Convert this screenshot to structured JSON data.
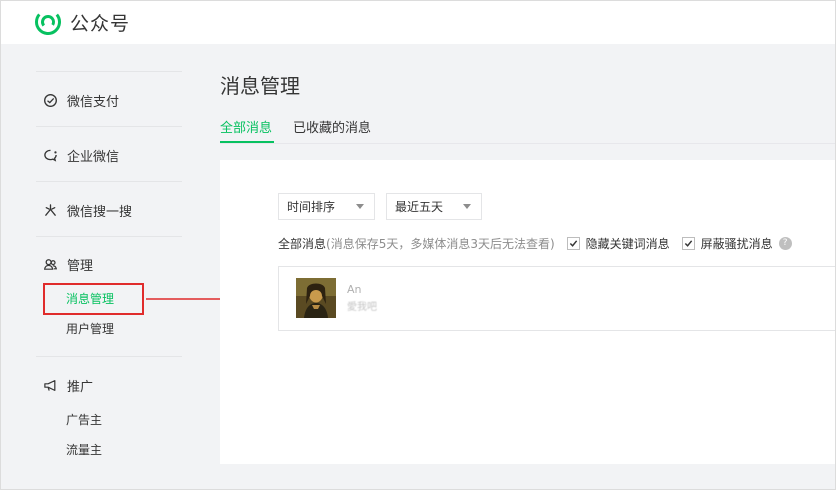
{
  "header": {
    "brand_name": "公众号",
    "logo_icon": "wechat-official-account-logo",
    "accent": "#07c160"
  },
  "sidebar": {
    "items": [
      {
        "label": "微信支付",
        "icon": "wechat-pay-icon"
      },
      {
        "label": "企业微信",
        "icon": "work-wechat-icon"
      },
      {
        "label": "微信搜一搜",
        "icon": "search-sparkle-icon"
      },
      {
        "label": "管理",
        "icon": "users-icon"
      },
      {
        "label": "推广",
        "icon": "megaphone-icon"
      }
    ],
    "manage_sub": [
      {
        "label": "消息管理",
        "active": true
      },
      {
        "label": "用户管理",
        "active": false
      }
    ],
    "promote_sub": [
      {
        "label": "广告主"
      },
      {
        "label": "流量主"
      }
    ]
  },
  "main": {
    "title": "消息管理",
    "tabs": [
      {
        "label": "全部消息",
        "active": true
      },
      {
        "label": "已收藏的消息",
        "active": false
      }
    ],
    "sort_select": {
      "value": "时间排序"
    },
    "range_select": {
      "value": "最近五天"
    },
    "filter": {
      "label": "全部消息",
      "note": "(消息保存5天，多媒体消息3天后无法查看)",
      "hide_keyword": {
        "label": "隐藏关键词消息",
        "checked": true
      },
      "block_harass": {
        "label": "屏蔽骚扰消息",
        "checked": true
      },
      "help": "?"
    },
    "message": {
      "sender": "An",
      "preview": "愛我吧"
    }
  },
  "annotation": {
    "box_color": "#e02b2b"
  }
}
